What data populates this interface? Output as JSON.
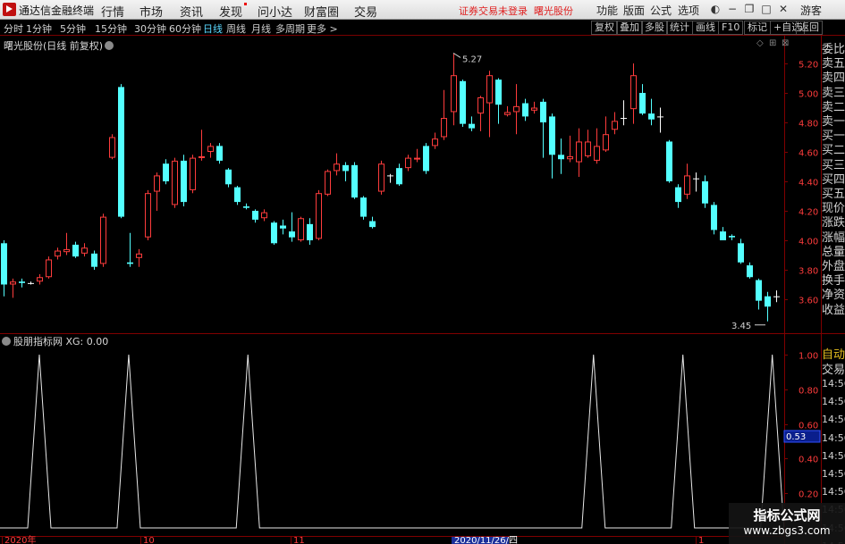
{
  "app": {
    "title": "通达信金融终端",
    "menu": [
      "行情",
      "市场",
      "资讯",
      "发现",
      "问小达",
      "财富圈",
      "交易"
    ],
    "alert": "证券交易未登录",
    "stock_link": "曙光股份",
    "right_menu": [
      "功能",
      "版面",
      "公式",
      "选项"
    ],
    "guest": "游客"
  },
  "toolbar": {
    "periods": [
      "分时",
      "1分钟",
      "5分钟",
      "15分钟",
      "30分钟",
      "60分钟",
      "日线",
      "周线",
      "月线",
      "多周期",
      "更多 >"
    ],
    "active_period": "日线",
    "buttons": [
      "复权",
      "叠加",
      "多股",
      "统计",
      "画线",
      "F10",
      "标记",
      "+自选",
      "返回"
    ]
  },
  "main_chart": {
    "title": "曙光股份(日线 前复权)",
    "high_marker": "5.27",
    "low_marker": "3.45",
    "price_ticks": [
      "5.20",
      "5.00",
      "4.80",
      "4.60",
      "4.40",
      "4.20",
      "4.00",
      "3.80",
      "3.60"
    ]
  },
  "indicator": {
    "title": "股朋指标网 XG: 0.00",
    "ticks": [
      "1.00",
      "0.80",
      "0.60",
      "0.40",
      "0.20"
    ],
    "current_value": "0.53"
  },
  "date_axis": [
    "2020年",
    "10",
    "11",
    "2020/11/26/四",
    "1"
  ],
  "quote_panel": [
    "委比",
    "卖五",
    "卖四",
    "卖三",
    "卖二",
    "卖一",
    "买一",
    "买二",
    "买三",
    "买四",
    "买五",
    "现价",
    "涨跌",
    "涨幅",
    "总量",
    "外盘",
    "换手",
    "净资",
    "收益"
  ],
  "trade_panel": {
    "auto": "自动",
    "label": "交易",
    "times": [
      "14:56",
      "14:56",
      "14:56",
      "14:56",
      "14:56",
      "14:56",
      "14:56",
      "14:56",
      "14:56",
      "14:56"
    ]
  },
  "watermark": {
    "title": "指标公式网",
    "url": "www.zbgs3.com"
  },
  "colors": {
    "up": "#ff3c3c",
    "down": "#54ffff",
    "grid": "#800000",
    "alert": "#e02020"
  },
  "chart_data": {
    "type": "candlestick",
    "price_range": [
      3.45,
      5.27
    ],
    "candles": [
      [
        3.98,
        3.7,
        4.0,
        3.62
      ],
      [
        3.7,
        3.72,
        3.74,
        3.61
      ],
      [
        3.72,
        3.71,
        3.74,
        3.68
      ],
      [
        3.71,
        3.71,
        3.72,
        3.7
      ],
      [
        3.72,
        3.75,
        3.77,
        3.7
      ],
      [
        3.75,
        3.87,
        3.89,
        3.74
      ],
      [
        3.89,
        3.93,
        3.95,
        3.87
      ],
      [
        3.92,
        3.94,
        4.05,
        3.9
      ],
      [
        3.97,
        3.89,
        3.99,
        3.88
      ],
      [
        3.91,
        3.95,
        3.98,
        3.89
      ],
      [
        3.91,
        3.82,
        3.93,
        3.8
      ],
      [
        3.84,
        4.16,
        4.18,
        3.82
      ],
      [
        4.56,
        4.7,
        4.72,
        4.55
      ],
      [
        5.04,
        4.16,
        5.06,
        4.15
      ],
      [
        3.85,
        3.84,
        4.05,
        3.82
      ],
      [
        3.88,
        3.91,
        3.94,
        3.82
      ],
      [
        4.02,
        4.32,
        4.34,
        4.0
      ],
      [
        4.33,
        4.44,
        4.46,
        4.2
      ],
      [
        4.52,
        4.4,
        4.55,
        4.38
      ],
      [
        4.24,
        4.54,
        4.56,
        4.22
      ],
      [
        4.54,
        4.26,
        4.58,
        4.23
      ],
      [
        4.34,
        4.56,
        4.58,
        4.32
      ],
      [
        4.56,
        4.57,
        4.75,
        4.54
      ],
      [
        4.6,
        4.64,
        4.66,
        4.56
      ],
      [
        4.64,
        4.54,
        4.66,
        4.52
      ],
      [
        4.48,
        4.38,
        4.49,
        4.36
      ],
      [
        4.36,
        4.26,
        4.37,
        4.24
      ],
      [
        4.23,
        4.22,
        4.25,
        4.21
      ],
      [
        4.2,
        4.14,
        4.21,
        4.12
      ],
      [
        4.15,
        4.19,
        4.21,
        4.13
      ],
      [
        4.12,
        3.98,
        4.13,
        3.97
      ],
      [
        4.1,
        4.08,
        4.14,
        4.04
      ],
      [
        4.06,
        4.02,
        4.19,
        3.99
      ],
      [
        4.0,
        4.15,
        4.16,
        3.99
      ],
      [
        4.11,
        4.0,
        4.15,
        3.97
      ],
      [
        4.01,
        4.32,
        4.34,
        4.0
      ],
      [
        4.31,
        4.47,
        4.48,
        4.3
      ],
      [
        4.47,
        4.52,
        4.59,
        4.44
      ],
      [
        4.51,
        4.47,
        4.53,
        4.4
      ],
      [
        4.51,
        4.29,
        4.53,
        4.28
      ],
      [
        4.29,
        4.16,
        4.3,
        4.14
      ],
      [
        4.13,
        4.09,
        4.16,
        4.08
      ],
      [
        4.33,
        4.52,
        4.54,
        4.31
      ],
      [
        4.44,
        4.44,
        4.45,
        4.39
      ],
      [
        4.49,
        4.38,
        4.52,
        4.37
      ],
      [
        4.49,
        4.56,
        4.58,
        4.47
      ],
      [
        4.55,
        4.56,
        4.62,
        4.53
      ],
      [
        4.64,
        4.47,
        4.66,
        4.45
      ],
      [
        4.64,
        4.69,
        4.73,
        4.62
      ],
      [
        4.7,
        4.83,
        5.02,
        4.68
      ],
      [
        4.87,
        5.12,
        5.27,
        4.78
      ],
      [
        5.08,
        4.79,
        5.09,
        4.77
      ],
      [
        4.79,
        4.76,
        4.84,
        4.74
      ],
      [
        4.86,
        4.97,
        4.98,
        4.74
      ],
      [
        4.93,
        5.12,
        5.15,
        4.7
      ],
      [
        5.09,
        4.92,
        5.1,
        4.79
      ],
      [
        4.85,
        4.87,
        4.91,
        4.84
      ],
      [
        4.87,
        4.91,
        5.06,
        4.72
      ],
      [
        4.93,
        4.84,
        4.96,
        4.81
      ],
      [
        4.88,
        4.9,
        4.94,
        4.86
      ],
      [
        4.94,
        4.8,
        4.96,
        4.56
      ],
      [
        4.84,
        4.58,
        4.86,
        4.42
      ],
      [
        4.58,
        4.55,
        4.69,
        4.45
      ],
      [
        4.55,
        4.57,
        4.71,
        4.53
      ],
      [
        4.53,
        4.67,
        4.76,
        4.43
      ],
      [
        4.57,
        4.67,
        4.75,
        4.56
      ],
      [
        4.54,
        4.64,
        4.76,
        4.52
      ],
      [
        4.61,
        4.72,
        4.84,
        4.6
      ],
      [
        4.75,
        4.81,
        4.87,
        4.72
      ],
      [
        4.83,
        4.83,
        4.95,
        4.78
      ],
      [
        4.89,
        5.12,
        5.2,
        4.79
      ],
      [
        5.0,
        4.86,
        5.06,
        4.85
      ],
      [
        4.86,
        4.82,
        4.96,
        4.78
      ],
      [
        4.84,
        4.84,
        4.9,
        4.73
      ],
      [
        4.67,
        4.4,
        4.68,
        4.39
      ],
      [
        4.36,
        4.26,
        4.38,
        4.22
      ],
      [
        4.31,
        4.44,
        4.52,
        4.28
      ],
      [
        4.42,
        4.42,
        4.46,
        4.33
      ],
      [
        4.4,
        4.25,
        4.44,
        4.22
      ],
      [
        4.24,
        4.07,
        4.26,
        4.04
      ],
      [
        4.06,
        4.0,
        4.09,
        4.02
      ],
      [
        4.03,
        4.02,
        4.04,
        4.0
      ],
      [
        3.98,
        3.85,
        4.01,
        3.84
      ],
      [
        3.83,
        3.75,
        3.85,
        3.74
      ],
      [
        3.73,
        3.59,
        3.74,
        3.53
      ],
      [
        3.62,
        3.55,
        3.65,
        3.45
      ],
      [
        3.62,
        3.62,
        3.66,
        3.58
      ]
    ],
    "indicator_peaks": [
      6,
      21,
      41,
      99,
      114,
      129
    ],
    "indicator_range": [
      0,
      1
    ]
  }
}
